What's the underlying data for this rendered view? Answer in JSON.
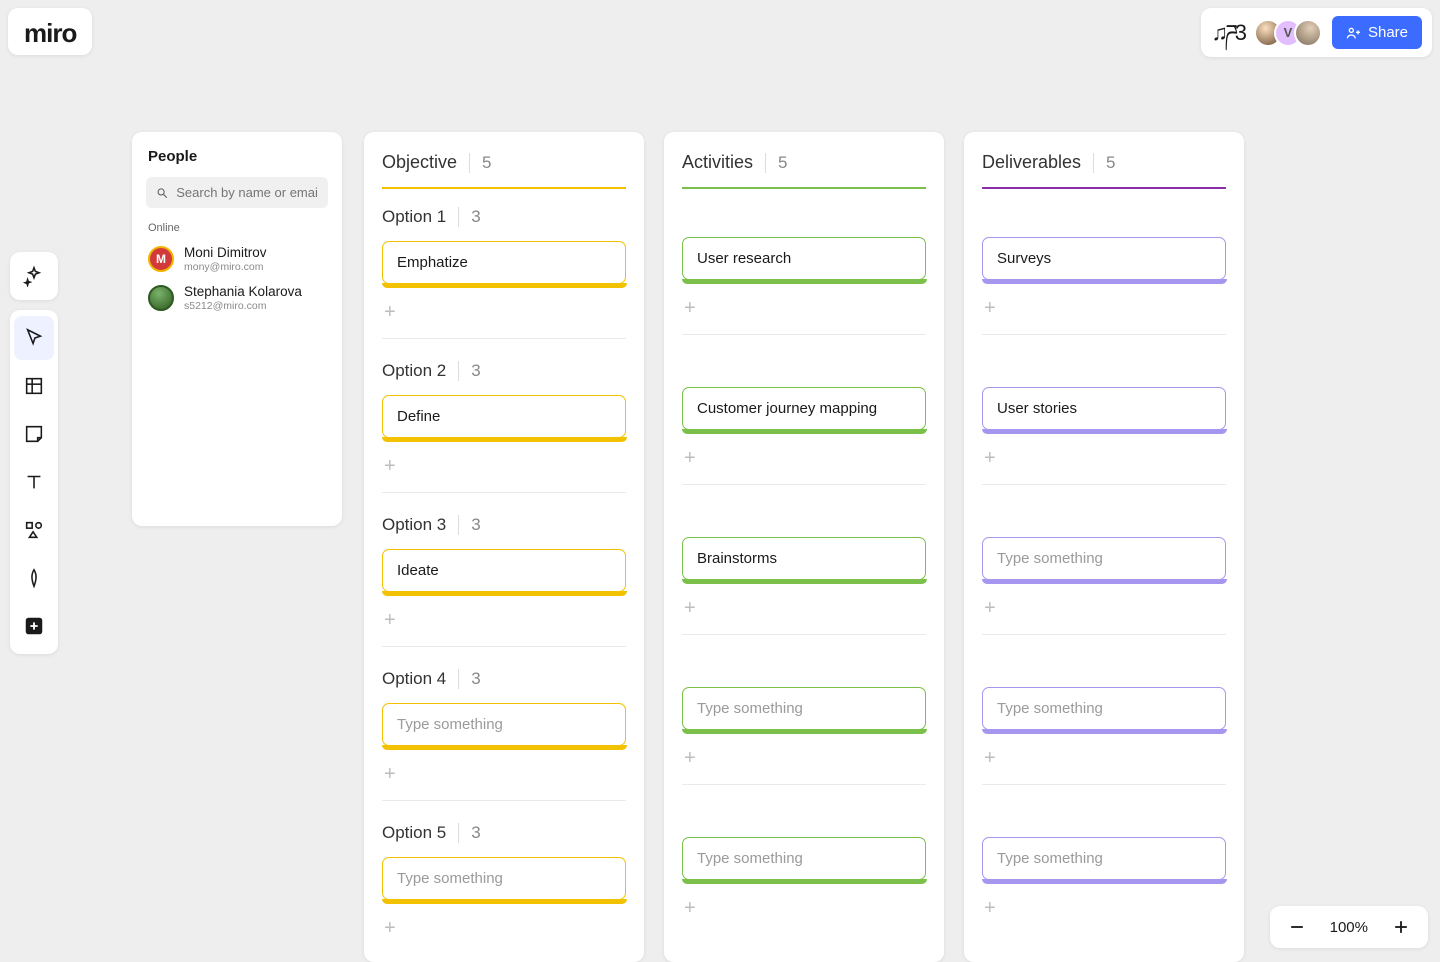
{
  "brand": {
    "name": "miro"
  },
  "topbar": {
    "reactions": "♫ཌ3",
    "avatars": [
      {
        "label": ""
      },
      {
        "label": "V"
      },
      {
        "label": ""
      }
    ],
    "share_label": "Share"
  },
  "toolbar": {
    "items": [
      "sparkle",
      "cursor",
      "frame",
      "note",
      "text",
      "shapes",
      "pen",
      "plus"
    ]
  },
  "people": {
    "title": "People",
    "search_placeholder": "Search by name or email",
    "status_label": "Online",
    "list": [
      {
        "initial": "M",
        "name": "Moni Dimitrov",
        "email": "mony@miro.com",
        "color": "red"
      },
      {
        "initial": "",
        "name": "Stephania Kolarova",
        "email": "s5212@miro.com",
        "color": "green"
      }
    ]
  },
  "board": {
    "columns": [
      {
        "key": "objective",
        "title": "Objective",
        "count": 5,
        "accent": "#f2c200"
      },
      {
        "key": "activities",
        "title": "Activities",
        "count": 5,
        "accent": "#7bc04a"
      },
      {
        "key": "deliverables",
        "title": "Deliverables",
        "count": 5,
        "accent": "#8a2fa8"
      }
    ],
    "options": [
      {
        "label": "Option 1",
        "count": 3,
        "cards": {
          "objective": "Emphatize",
          "activities": "User research",
          "deliverables": "Surveys"
        }
      },
      {
        "label": "Option 2",
        "count": 3,
        "cards": {
          "objective": "Define",
          "activities": "Customer journey mapping",
          "deliverables": "User stories"
        }
      },
      {
        "label": "Option 3",
        "count": 3,
        "cards": {
          "objective": "Ideate",
          "activities": "Brainstorms",
          "deliverables": ""
        }
      },
      {
        "label": "Option 4",
        "count": 3,
        "cards": {
          "objective": "",
          "activities": "",
          "deliverables": ""
        }
      },
      {
        "label": "Option 5",
        "count": 3,
        "cards": {
          "objective": "",
          "activities": "",
          "deliverables": ""
        }
      }
    ],
    "placeholder": "Type something"
  },
  "zoom": {
    "level": "100%"
  }
}
